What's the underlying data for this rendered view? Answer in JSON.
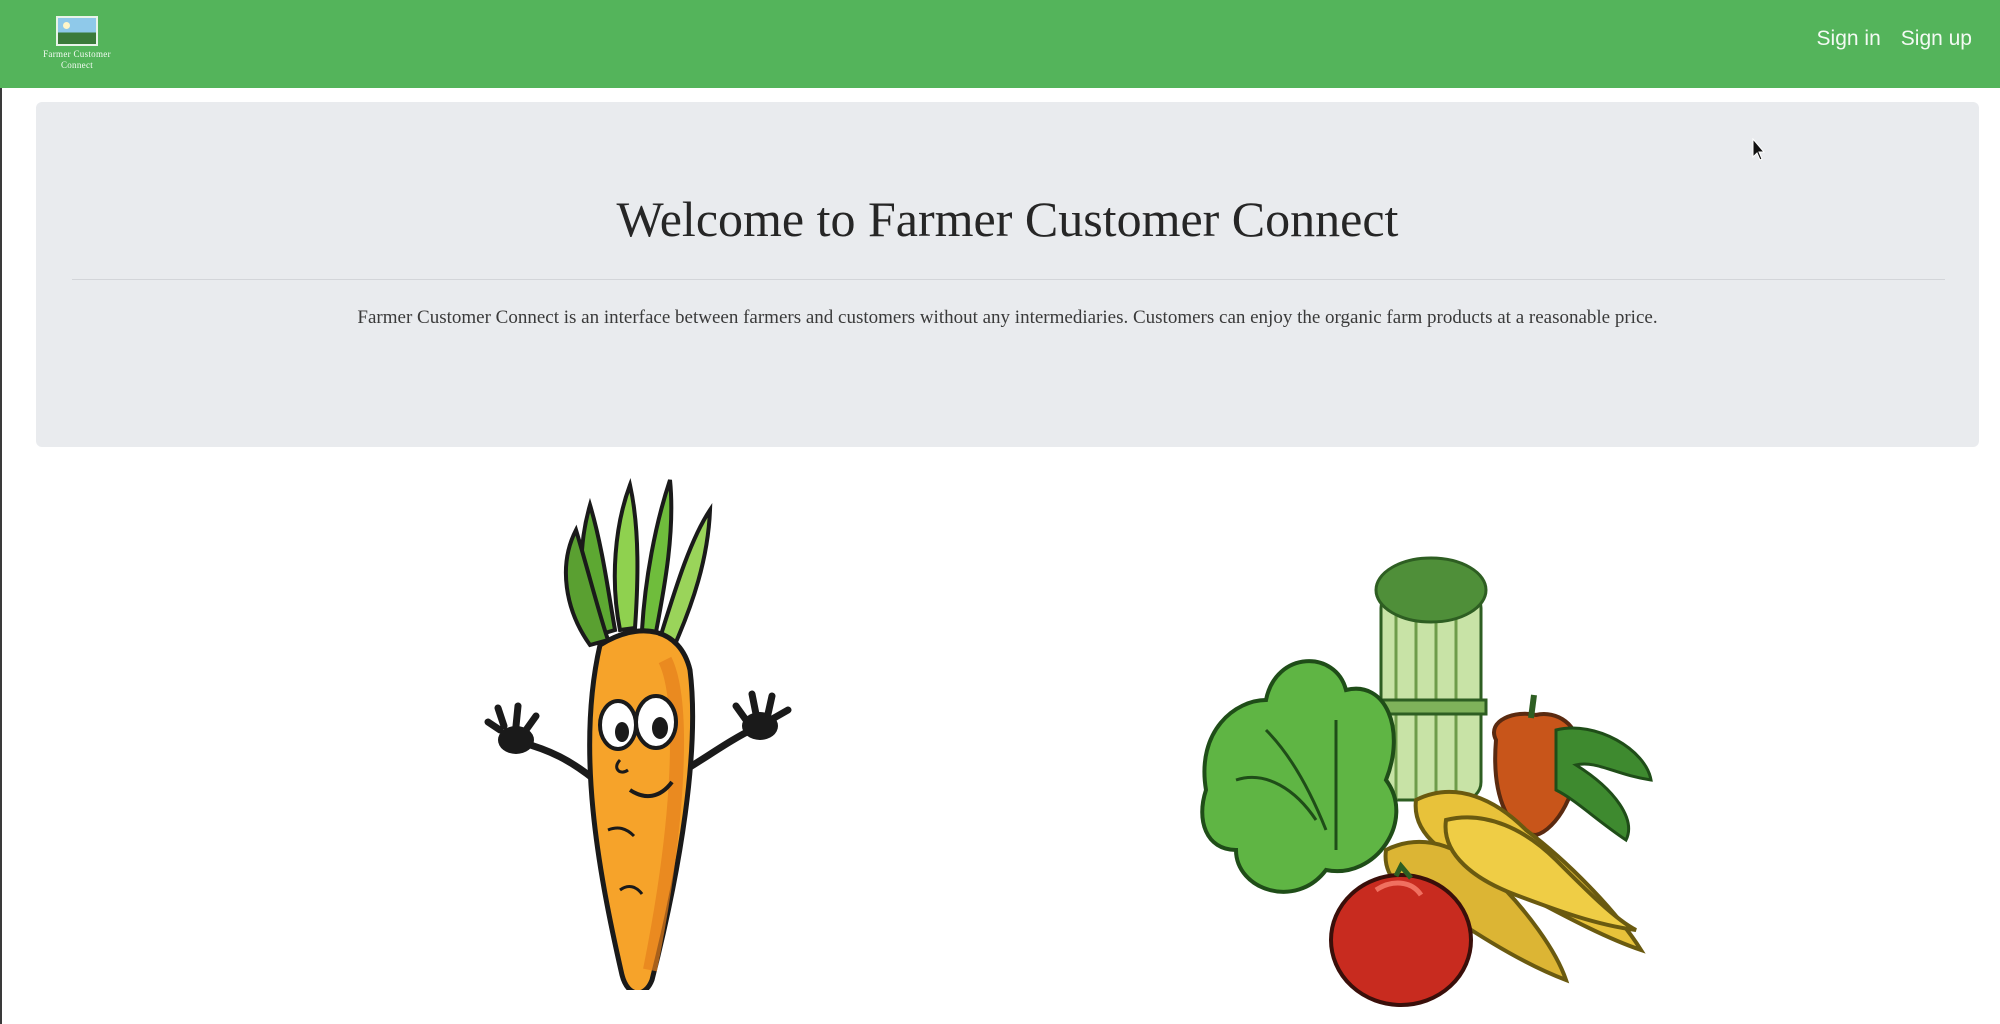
{
  "brand": {
    "logo_line1": "Farmer Customer",
    "logo_line2": "Connect"
  },
  "nav": {
    "sign_in": "Sign in",
    "sign_up": "Sign up"
  },
  "hero": {
    "title": "Welcome to Farmer Customer Connect",
    "description": "Farmer Customer Connect is an interface between farmers and customers without any intermediaries. Customers can enjoy the organic farm products at a reasonable price."
  },
  "colors": {
    "navbar": "#54b45b",
    "jumbotron": "#e9ebee"
  },
  "images": [
    "carrot-cartoon",
    "vegetable-bundle"
  ]
}
